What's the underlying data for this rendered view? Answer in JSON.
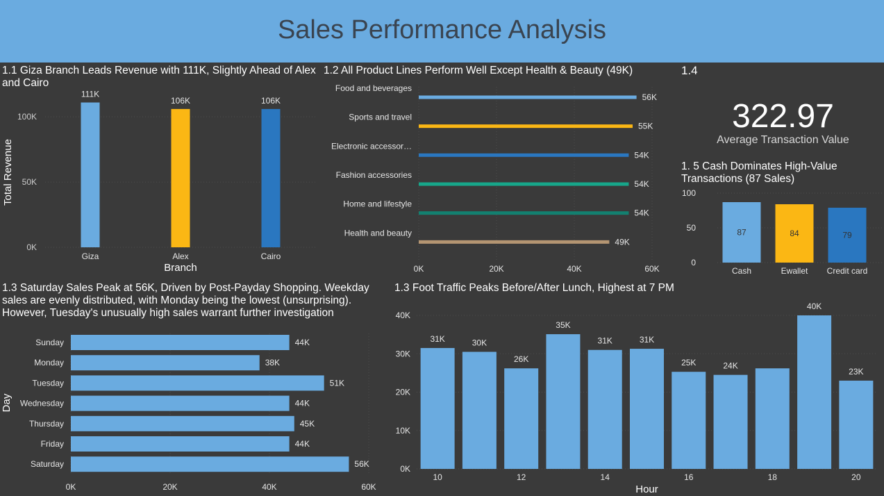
{
  "header": {
    "title": "Sales Performance Analysis"
  },
  "colors": {
    "header_bg": "#6aabe0",
    "background": "#3a3a3a",
    "light_blue": "#6aabe0",
    "gold": "#fbb714",
    "dark_blue": "#2a77c0",
    "teal": "#17a68a",
    "dark_teal": "#138070",
    "tan": "#b49572"
  },
  "kpi": {
    "title": "1.4",
    "value": "322.97",
    "label": "Average Transaction Value"
  },
  "chart_data": [
    {
      "id": "branch",
      "type": "bar",
      "title": "1.1 Giza Branch Leads Revenue with 111K, Slightly Ahead of Alex and Cairo",
      "xlabel": "Branch",
      "ylabel": "Total Revenue",
      "categories": [
        "Giza",
        "Alex",
        "Cairo"
      ],
      "values": [
        111,
        106,
        106
      ],
      "data_labels": [
        "111K",
        "106K",
        "106K"
      ],
      "colors": [
        "#6aabe0",
        "#fbb714",
        "#2a77c0"
      ],
      "ylim": [
        0,
        115
      ],
      "yticks": [
        0,
        50,
        100
      ],
      "ytick_labels": [
        "0K",
        "50K",
        "100K"
      ],
      "grid": true
    },
    {
      "id": "product",
      "type": "bar",
      "orientation": "horizontal",
      "title": "1.2 All Product Lines Perform Well Except Health & Beauty (49K)",
      "categories": [
        "Food and beverages",
        "Sports and travel",
        "Electronic accessor…",
        "Fashion accessories",
        "Home and lifestyle",
        "Health and beauty"
      ],
      "values": [
        56,
        55,
        54,
        54,
        54,
        49
      ],
      "data_labels": [
        "56K",
        "55K",
        "54K",
        "54K",
        "54K",
        "49K"
      ],
      "colors": [
        "#6aabe0",
        "#fbb714",
        "#2a77c0",
        "#17a68a",
        "#138070",
        "#b49572"
      ],
      "xlim": [
        0,
        60
      ],
      "xticks": [
        0,
        20,
        40,
        60
      ],
      "xtick_labels": [
        "0K",
        "20K",
        "40K",
        "60K"
      ],
      "grid": true
    },
    {
      "id": "payment",
      "type": "bar",
      "title": "1. 5 Cash Dominates High-Value Transactions (87 Sales)",
      "categories": [
        "Cash",
        "Ewallet",
        "Credit card"
      ],
      "values": [
        87,
        84,
        79
      ],
      "data_labels": [
        "87",
        "84",
        "79"
      ],
      "colors": [
        "#6aabe0",
        "#fbb714",
        "#2a77c0"
      ],
      "ylim": [
        0,
        100
      ],
      "yticks": [
        0,
        50,
        100
      ],
      "ytick_labels": [
        "0",
        "50",
        "100"
      ],
      "grid": true
    },
    {
      "id": "day",
      "type": "bar",
      "orientation": "horizontal",
      "title": "1.3 Saturday Sales Peak at 56K, Driven by Post-Payday Shopping. Weekday sales are evenly distributed, with Monday being the lowest (unsurprising). However, Tuesday's unusually high sales warrant further investigation",
      "ylabel": "Day",
      "categories": [
        "Sunday",
        "Monday",
        "Tuesday",
        "Wednesday",
        "Thursday",
        "Friday",
        "Saturday"
      ],
      "values": [
        44,
        38,
        51,
        44,
        45,
        44,
        56
      ],
      "data_labels": [
        "44K",
        "38K",
        "51K",
        "44K",
        "45K",
        "44K",
        "56K"
      ],
      "color": "#6aabe0",
      "xlim": [
        0,
        60
      ],
      "xticks": [
        0,
        20,
        40,
        60
      ],
      "xtick_labels": [
        "0K",
        "20K",
        "40K",
        "60K"
      ],
      "grid": true
    },
    {
      "id": "hour",
      "type": "bar",
      "title": "1.3 Foot Traffic Peaks Before/After Lunch, Highest at 7 PM",
      "xlabel": "Hour",
      "categories": [
        10,
        11,
        12,
        13,
        14,
        15,
        16,
        17,
        18,
        19,
        20
      ],
      "values": [
        31.5,
        30.5,
        26.2,
        35.1,
        31,
        31.3,
        25.3,
        24.5,
        26.2,
        40,
        23
      ],
      "data_labels": [
        "31K",
        "30K",
        "26K",
        "35K",
        "31K",
        "31K",
        "25K",
        "24K",
        "",
        "40K",
        "23K"
      ],
      "color": "#6aabe0",
      "xtick_labels": [
        "10",
        "",
        "12",
        "",
        "14",
        "",
        "16",
        "",
        "18",
        "",
        "20"
      ],
      "ylim": [
        0,
        40
      ],
      "yticks": [
        0,
        10,
        20,
        30,
        40
      ],
      "ytick_labels": [
        "0K",
        "10K",
        "20K",
        "30K",
        "40K"
      ],
      "grid": true
    }
  ]
}
